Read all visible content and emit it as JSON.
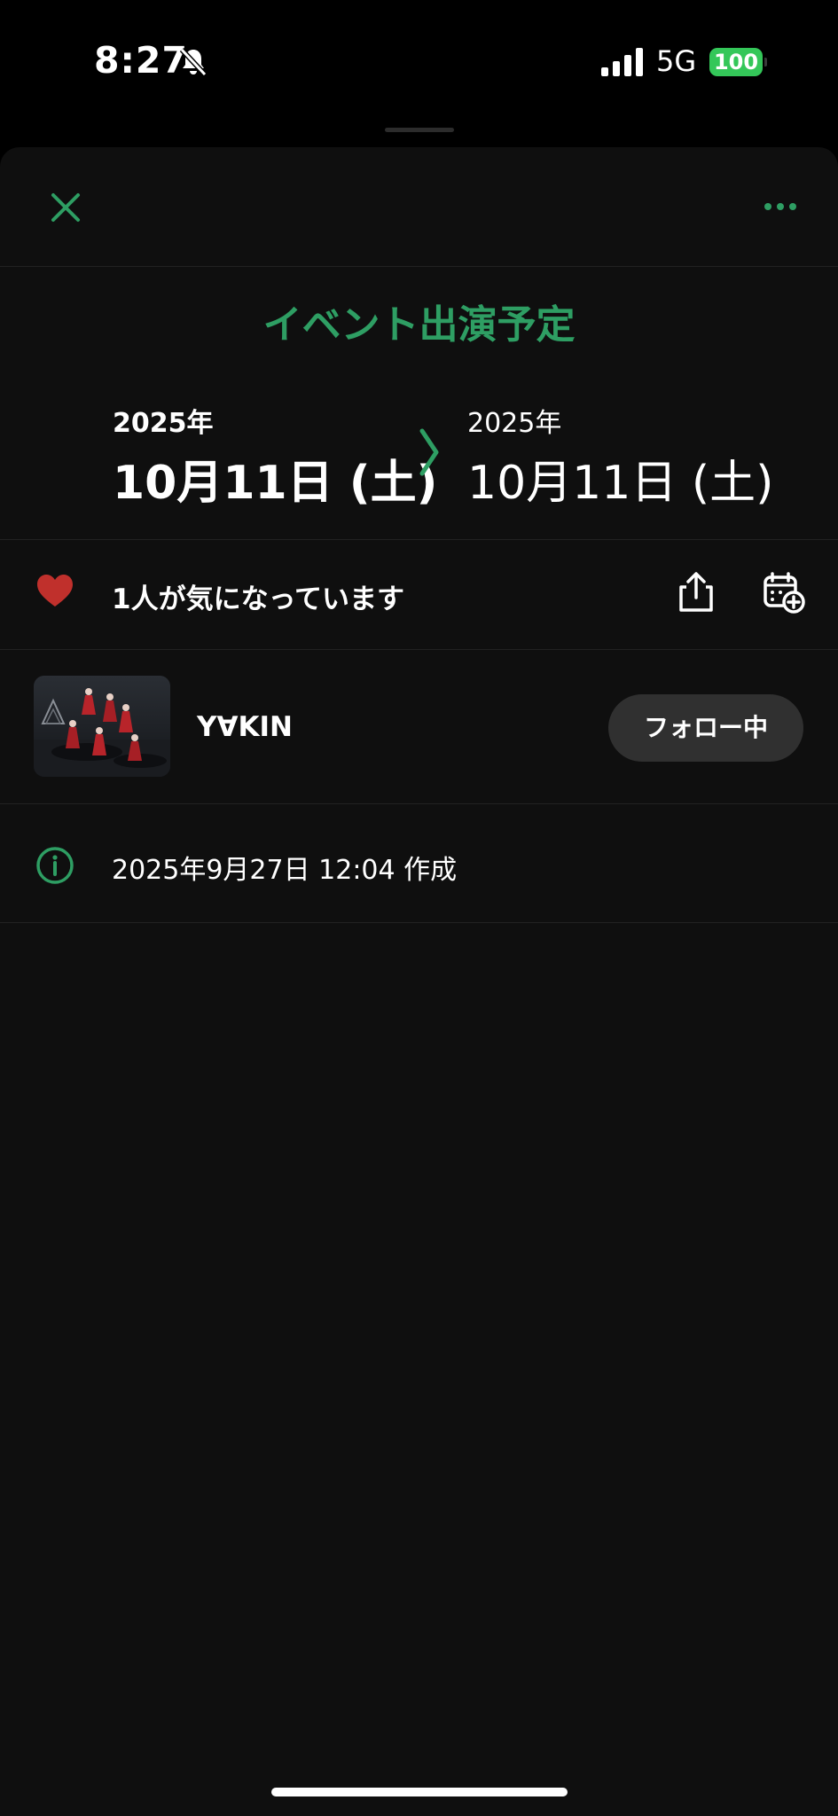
{
  "status_bar": {
    "time": "8:27",
    "network": "5G",
    "battery": "100",
    "icons": [
      "bell-slash-icon",
      "signal-icon",
      "battery-icon"
    ]
  },
  "colors": {
    "accent": "#2e9e63",
    "heart": "#c0302c",
    "background": "#0f0f0f",
    "button": "#303030"
  },
  "header": {
    "close_icon": "close-icon",
    "more_icon": "more-icon"
  },
  "event": {
    "title": "イベント出演予定",
    "start": {
      "year": "2025年",
      "day": "10月11日 (土)"
    },
    "end": {
      "year": "2025年",
      "day": "10月11日 (土)"
    }
  },
  "interest": {
    "text": "1人が気になっています",
    "icons": [
      "heart-icon",
      "share-icon",
      "calendar-add-icon"
    ]
  },
  "artist": {
    "name": "Y∀KIN",
    "follow_label": "フォロー中"
  },
  "info": {
    "created": "2025年9月27日 12:04 作成",
    "icon": "info-icon"
  }
}
